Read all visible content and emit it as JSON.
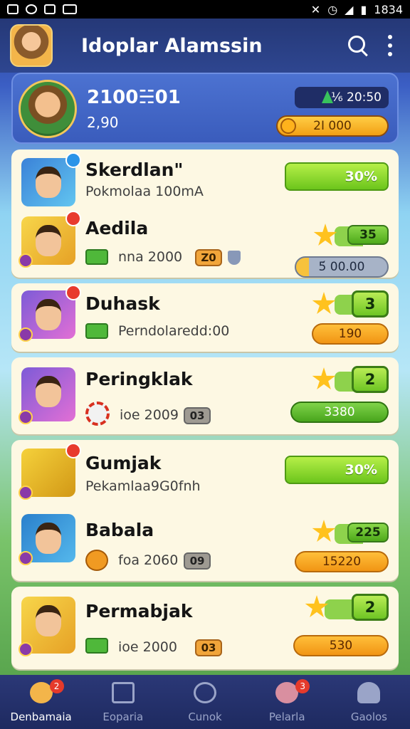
{
  "status_bar": {
    "time": "1834"
  },
  "app": {
    "title": "Idoplar Alamssin"
  },
  "profile": {
    "score": "2100☵01",
    "sub": "2,90",
    "gems": "⅙ 20:50",
    "coins": "2Ι 000"
  },
  "entries": [
    {
      "name": "Skerdlan\"",
      "sub": "Pokmolaa 100mA",
      "pct": "30%"
    },
    {
      "name": "Aedila",
      "sub": "nna 2000",
      "chip": "Z0",
      "rank": "35",
      "bar": "5́ 00.00"
    },
    {
      "name": "Duhask",
      "sub": "Perndolaredd:00",
      "rank": "3",
      "bar": "190"
    },
    {
      "name": "Peringklak",
      "sub": "ioe 2009",
      "chip": "03",
      "rank": "2",
      "bar": "3380"
    },
    {
      "name": "Gumjak",
      "sub": "Pekamlaa9G0fnh",
      "pct": "30%"
    },
    {
      "name": "Babala",
      "sub": "foa 2060",
      "chip": "09",
      "rank": "225",
      "bar": "15220"
    },
    {
      "name": "Permabjak",
      "sub": "ioe 2000",
      "chip": "03",
      "rank": "2",
      "bar": "530"
    }
  ],
  "nav": [
    {
      "label": "Denbamaia",
      "badge": "2"
    },
    {
      "label": "Eoparia",
      "badge": ""
    },
    {
      "label": "Cunok",
      "badge": ""
    },
    {
      "label": "Pelarla",
      "badge": "3"
    },
    {
      "label": "Gaolos",
      "badge": ""
    }
  ],
  "colors": {
    "accent": "#6cc51c",
    "header": "#253877",
    "card": "#fdf8e3",
    "coin": "#f19514"
  }
}
